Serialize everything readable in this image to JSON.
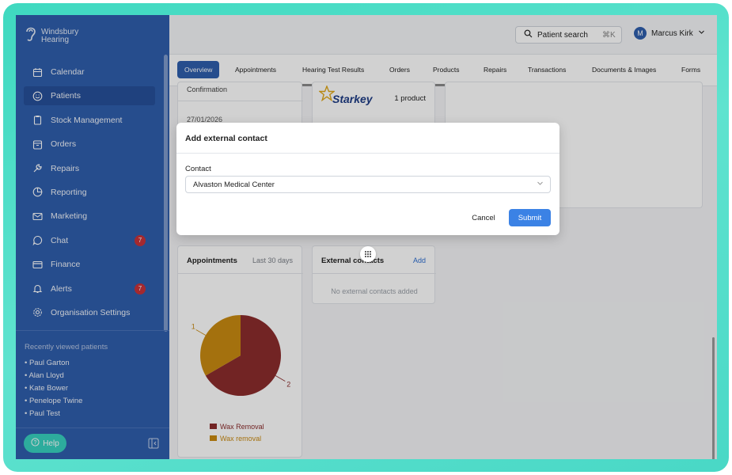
{
  "brand": {
    "line1": "Windsbury",
    "line2": "Hearing"
  },
  "sidebar": {
    "items": [
      {
        "label": "Calendar",
        "icon": "calendar-icon"
      },
      {
        "label": "Patients",
        "icon": "smiley-icon",
        "active": true
      },
      {
        "label": "Stock Management",
        "icon": "clipboard-icon"
      },
      {
        "label": "Orders",
        "icon": "box-icon"
      },
      {
        "label": "Repairs",
        "icon": "wrench-icon"
      },
      {
        "label": "Reporting",
        "icon": "piechart-icon"
      },
      {
        "label": "Marketing",
        "icon": "mail-icon"
      },
      {
        "label": "Chat",
        "icon": "chat-icon",
        "badge": "7"
      },
      {
        "label": "Finance",
        "icon": "card-icon"
      },
      {
        "label": "Alerts",
        "icon": "bell-icon",
        "badge": "7"
      },
      {
        "label": "Organisation Settings",
        "icon": "gear-icon"
      }
    ],
    "recent_title": "Recently viewed patients",
    "recent": [
      "• Paul Garton",
      "• Alan Lloyd",
      "• Kate Bower",
      "• Penelope Twine",
      "• Paul Test"
    ],
    "help_label": "Help"
  },
  "topbar": {
    "search_label": "Patient search",
    "search_kbd": "⌘K",
    "avatar_initial": "M",
    "user_name": "Marcus Kirk"
  },
  "tabs": [
    "Overview",
    "Appointments",
    "Hearing Test Results",
    "Orders",
    "Products",
    "Repairs",
    "Transactions",
    "Documents & Images",
    "Forms"
  ],
  "content": {
    "confirmation_label": "Confirmation",
    "date": "27/01/2026",
    "starkey_logo": "Starkey",
    "product_count": "1 product",
    "appointments_title": "Appointments",
    "appointments_range": "Last 30 days",
    "external_title": "External contacts",
    "external_add": "Add",
    "external_empty": "No external contacts added"
  },
  "chart_data": {
    "type": "pie",
    "labels": [
      "Wax Removal",
      "Wax removal"
    ],
    "values": [
      2,
      1
    ],
    "colors": [
      "#8b2c2c",
      "#c98a12"
    ],
    "legend": "bottom"
  },
  "modal": {
    "title": "Add external contact",
    "field_label": "Contact",
    "field_value": "Alvaston Medical Center",
    "cancel_label": "Cancel",
    "submit_label": "Submit"
  }
}
